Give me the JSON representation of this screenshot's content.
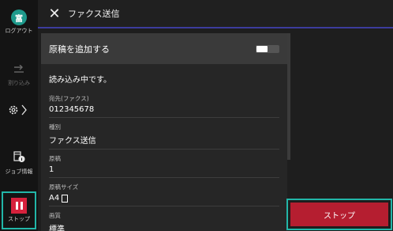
{
  "sidebar": {
    "logout_badge": "富",
    "logout_label": "ログアウト",
    "interrupt_label": "割り込み",
    "job_info_label": "ジョブ情報",
    "stop_label": "ストップ"
  },
  "header": {
    "title": "ファクス送信"
  },
  "panel": {
    "add_original_label": "原稿を追加する",
    "toggle_text": "II",
    "status_text": "読み込み中です。",
    "fields": [
      {
        "label": "宛先(ファクス)",
        "value": "012345678"
      },
      {
        "label": "種別",
        "value": "ファクス送信"
      },
      {
        "label": "原稿",
        "value": "1"
      },
      {
        "label": "原稿サイズ",
        "value": "A4"
      },
      {
        "label": "画質",
        "value": "標準"
      }
    ]
  },
  "stop_button_label": "ストップ",
  "colors": {
    "accent_teal": "#22b6a8",
    "stop_red": "#b51e30",
    "logout_green": "#1e9a8c"
  }
}
